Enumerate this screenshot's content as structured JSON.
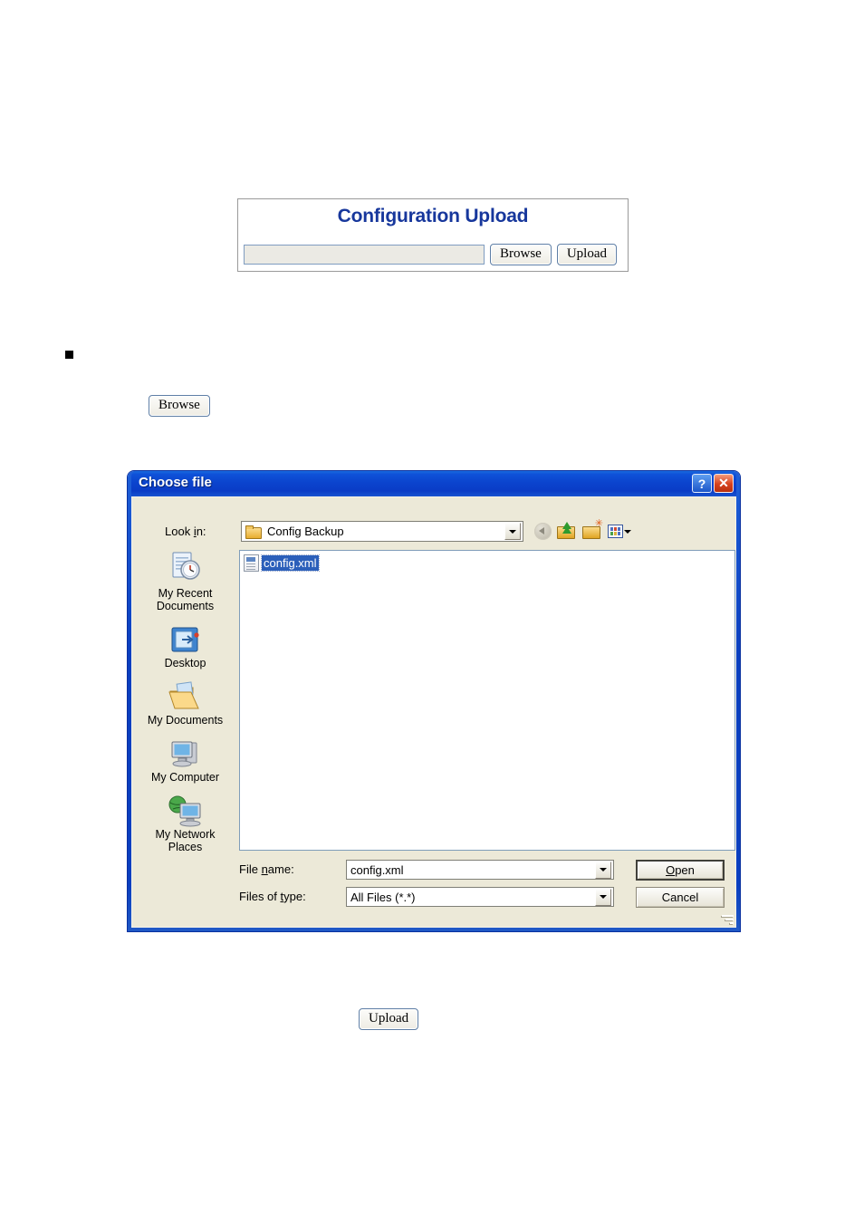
{
  "upload_panel": {
    "title": "Configuration Upload",
    "file_path_value": "",
    "file_path_placeholder": "",
    "browse_label": "Browse",
    "upload_label": "Upload"
  },
  "standalone": {
    "browse_label": "Browse",
    "upload_label": "Upload"
  },
  "dialog": {
    "title": "Choose file",
    "help_label": "?",
    "close_label": "✕",
    "lookin": {
      "label_pre": "Look ",
      "label_key": "i",
      "label_post": "n:",
      "value": "Config Backup"
    },
    "toolbar": [
      {
        "name": "back-icon",
        "tooltip": "Back"
      },
      {
        "name": "up-one-level-icon",
        "tooltip": "Up One Level"
      },
      {
        "name": "new-folder-icon",
        "tooltip": "Create New Folder"
      },
      {
        "name": "views-icon",
        "tooltip": "Views"
      }
    ],
    "places": [
      {
        "label": "My Recent Documents",
        "icon": "recent-documents-icon"
      },
      {
        "label": "Desktop",
        "icon": "desktop-icon"
      },
      {
        "label": "My Documents",
        "icon": "my-documents-icon"
      },
      {
        "label": "My Computer",
        "icon": "my-computer-icon"
      },
      {
        "label": "My Network Places",
        "icon": "my-network-places-icon"
      }
    ],
    "files": [
      {
        "name": "config.xml",
        "selected": true,
        "icon": "xml-file-icon"
      }
    ],
    "file_name": {
      "label_pre": "File ",
      "label_key": "n",
      "label_post": "ame:",
      "value": "config.xml"
    },
    "files_of_type": {
      "label_pre": "Files of ",
      "label_key": "t",
      "label_post": "ype:",
      "value": "All Files (*.*)"
    },
    "open_label_key": "O",
    "open_label_rest": "pen",
    "cancel_label": "Cancel"
  },
  "colors": {
    "heading_blue": "#17379c",
    "titlebar_blue": "#0b44ce",
    "dialog_face": "#ece9d8",
    "selection_blue": "#2b5fba",
    "close_red": "#d6411d"
  }
}
